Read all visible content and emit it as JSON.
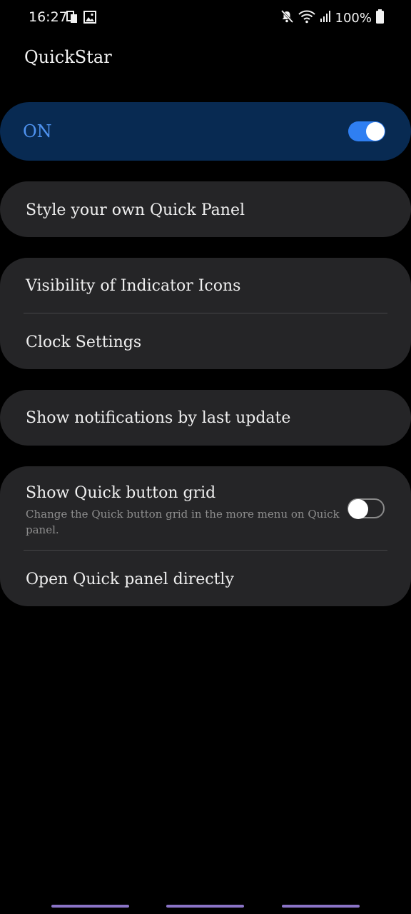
{
  "status_bar": {
    "time": "16:27",
    "battery_text": "100%",
    "icons": [
      "screen-mirror-icon",
      "image-icon",
      "mute-icon",
      "wifi-icon",
      "signal-icon",
      "battery-icon"
    ]
  },
  "app": {
    "title": "QuickStar"
  },
  "master": {
    "label": "ON",
    "enabled": true
  },
  "items": {
    "style_panel": "Style your own Quick Panel",
    "visibility_icons": "Visibility of Indicator Icons",
    "clock_settings": "Clock Settings",
    "show_notifications": "Show notifications by last update",
    "quick_button_grid": {
      "title": "Show Quick button grid",
      "subtitle": "Change the Quick button grid in the more menu on Quick panel.",
      "enabled": false
    },
    "open_quick_panel": "Open Quick panel directly"
  },
  "colors": {
    "accent": "#2f7ff2",
    "master_bg": "#082a52",
    "card_bg": "#252527",
    "nav_pill": "#8a73c6"
  }
}
